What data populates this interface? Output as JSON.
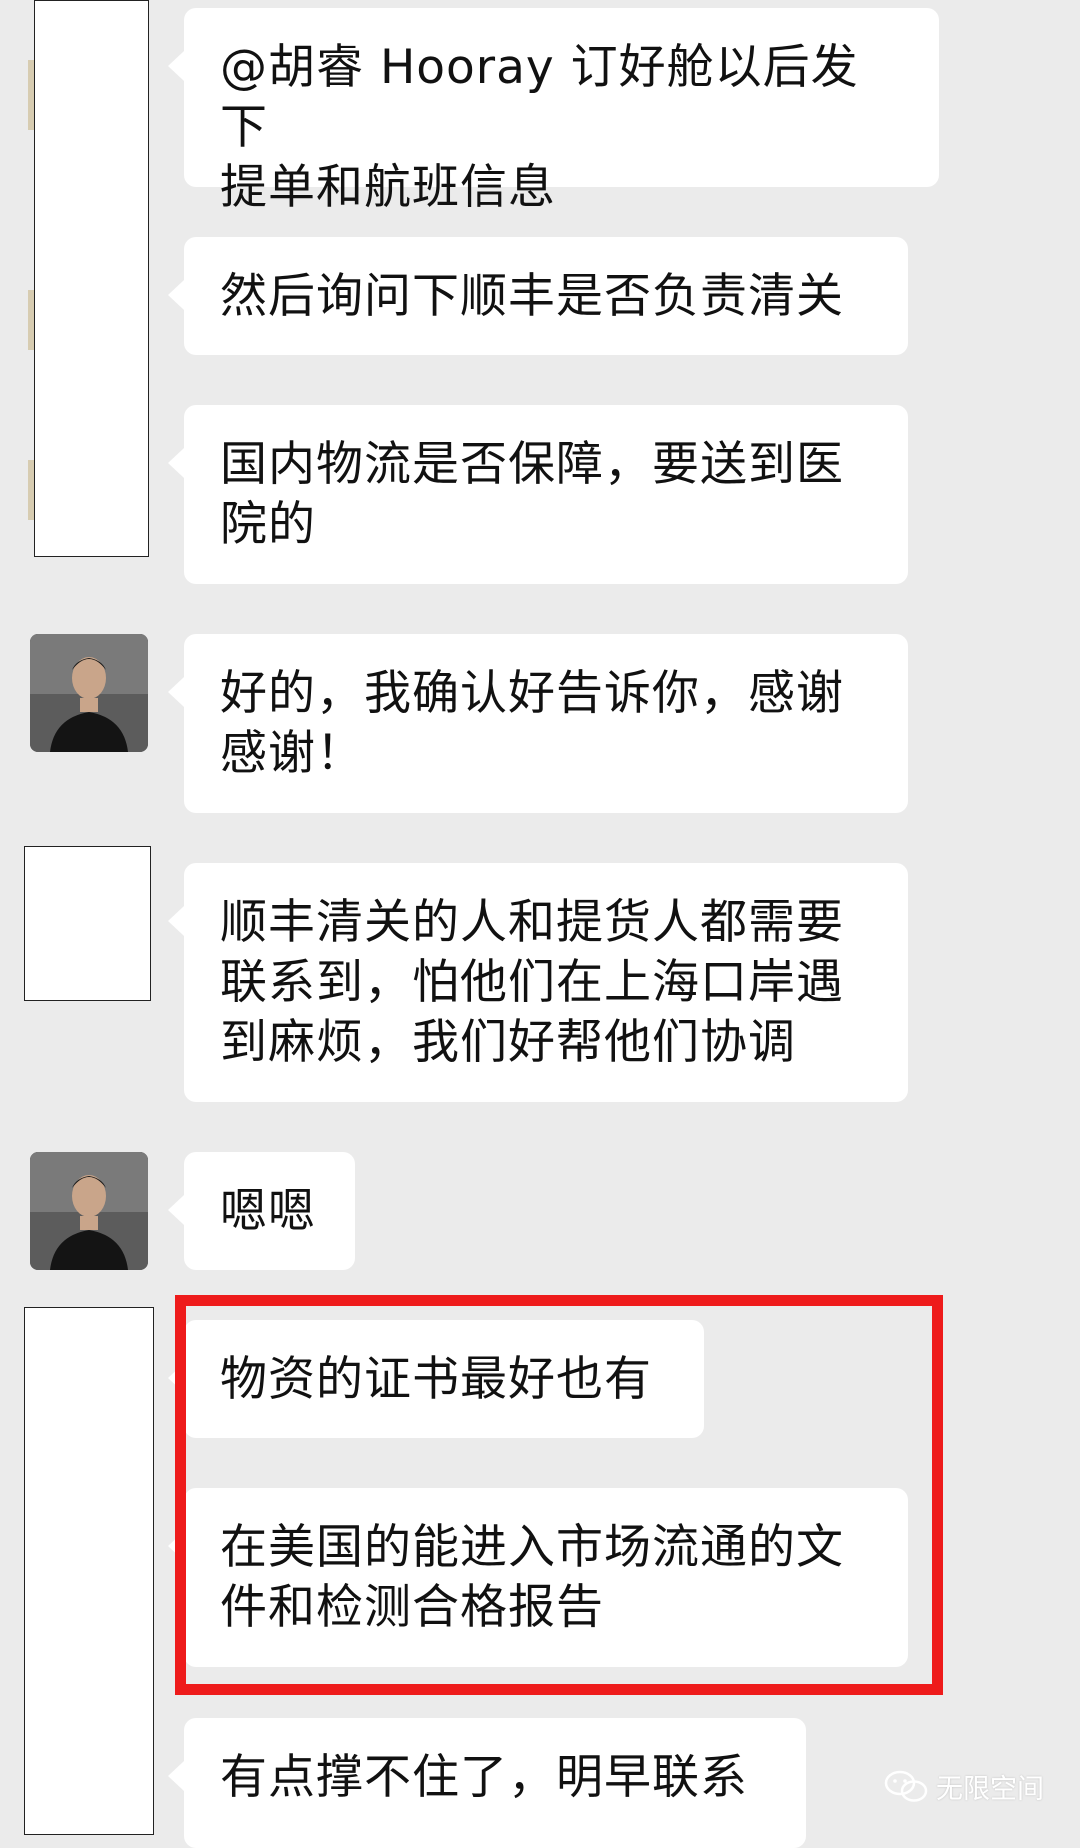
{
  "chat": {
    "messages": [
      {
        "text": "@胡睿 Hooray 订好舱以后发下\n提单和航班信息"
      },
      {
        "text": "然后询问下顺丰是否负责清关"
      },
      {
        "text": "国内物流是否保障，要送到医\n院的"
      },
      {
        "text": "好的，我确认好告诉你，感谢\n感谢！"
      },
      {
        "text": "顺丰清关的人和提货人都需要\n联系到，怕他们在上海口岸遇\n到麻烦，我们好帮他们协调"
      },
      {
        "text": "嗯嗯"
      },
      {
        "text": "物资的证书最好也有"
      },
      {
        "text": "在美国的能进入市场流通的文\n件和检测合格报告"
      },
      {
        "text": "有点撑不住了，明早联系"
      }
    ]
  },
  "watermark": {
    "text": "无限空间",
    "icon": "wechat-icon"
  }
}
